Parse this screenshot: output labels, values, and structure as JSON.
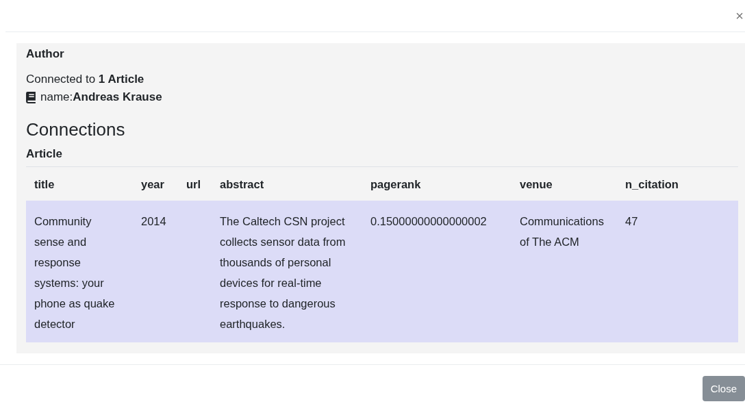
{
  "close_icon": "×",
  "node": {
    "label": "Author",
    "connected": "Connected to **1 Article**",
    "property": "name:**Andreas Krause**"
  },
  "connections": {
    "heading": "Connections",
    "group": "Article",
    "table": {
      "columns": [
        "title",
        "year",
        "url",
        "abstract",
        "pagerank",
        "venue",
        "n_citation"
      ],
      "rows": [
        {
          "selected": true,
          "cells": [
            "Community sense and response systems: your phone as quake detector",
            "2014",
            "",
            "The Caltech CSN project collects sensor data from thousands of personal devices for real-time response to dangerous earthquakes.",
            "0.15000000000000002",
            "Communications of The ACM",
            "47"
          ]
        }
      ]
    }
  },
  "footer": {
    "button": "Close"
  }
}
